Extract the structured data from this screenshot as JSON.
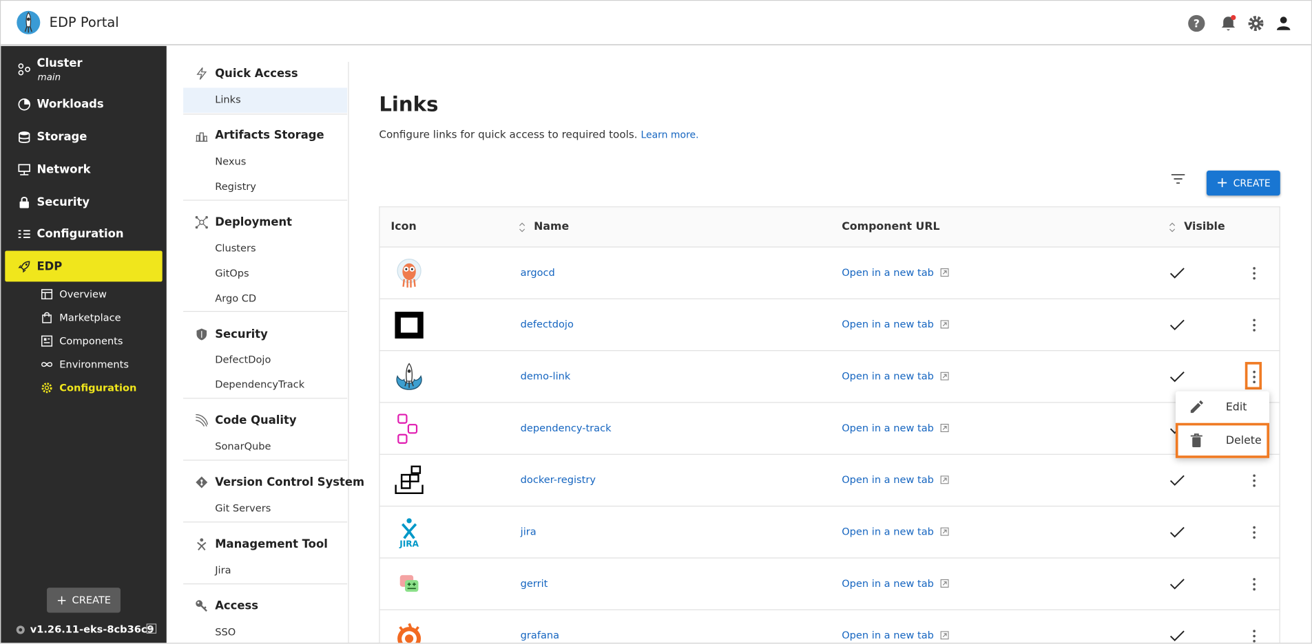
{
  "app": {
    "title": "EDP Portal"
  },
  "header": {
    "icons": [
      "help-icon",
      "notifications-icon",
      "settings-icon",
      "account-icon"
    ],
    "notification_dot_color": "#e53935"
  },
  "leftnav": {
    "items": [
      {
        "label": "Cluster",
        "sublabel": "main",
        "icon": "cluster-icon"
      },
      {
        "label": "Workloads",
        "icon": "workloads-icon"
      },
      {
        "label": "Storage",
        "icon": "storage-icon"
      },
      {
        "label": "Network",
        "icon": "network-icon"
      },
      {
        "label": "Security",
        "icon": "lock-icon"
      },
      {
        "label": "Configuration",
        "icon": "configuration-icon"
      },
      {
        "label": "EDP",
        "icon": "rocket-icon",
        "active": true
      }
    ],
    "subitems": [
      {
        "label": "Overview",
        "icon": "overview-icon"
      },
      {
        "label": "Marketplace",
        "icon": "marketplace-icon"
      },
      {
        "label": "Components",
        "icon": "components-icon"
      },
      {
        "label": "Environments",
        "icon": "environments-icon"
      },
      {
        "label": "Configuration",
        "icon": "gear-icon",
        "active": true
      }
    ],
    "create_label": "CREATE",
    "version": "v1.26.11-eks-8cb36c9",
    "active_color": "#f0e61c"
  },
  "subnav": {
    "sections": [
      {
        "title": "Quick Access",
        "icon": "bolt-icon",
        "links": [
          "Links"
        ]
      },
      {
        "title": "Artifacts Storage",
        "icon": "artifacts-icon",
        "links": [
          "Nexus",
          "Registry"
        ]
      },
      {
        "title": "Deployment",
        "icon": "deployment-icon",
        "links": [
          "Clusters",
          "GitOps",
          "Argo CD"
        ]
      },
      {
        "title": "Security",
        "icon": "shield-icon",
        "links": [
          "DefectDojo",
          "DependencyTrack"
        ]
      },
      {
        "title": "Code Quality",
        "icon": "code-quality-icon",
        "links": [
          "SonarQube"
        ]
      },
      {
        "title": "Version Control System",
        "icon": "git-icon",
        "links": [
          "Git Servers"
        ]
      },
      {
        "title": "Management Tool",
        "icon": "management-icon",
        "links": [
          "Jira"
        ]
      },
      {
        "title": "Access",
        "icon": "key-icon",
        "links": [
          "SSO"
        ]
      }
    ],
    "active_link": "Links"
  },
  "main": {
    "title": "Links",
    "description": "Configure links for quick access to required tools.",
    "learn_more": "Learn more.",
    "create_label": "CREATE",
    "accent_color": "#1976d2"
  },
  "table": {
    "columns": [
      "Icon",
      "Name",
      "Component URL",
      "Visible"
    ],
    "rows": [
      {
        "icon": "argocd-icon",
        "name": "argocd",
        "url_label": "Open in a new tab",
        "visible": true
      },
      {
        "icon": "defectdojo-icon",
        "name": "defectdojo",
        "url_label": "Open in a new tab",
        "visible": true
      },
      {
        "icon": "demo-link-icon",
        "name": "demo-link",
        "url_label": "Open in a new tab",
        "visible": true
      },
      {
        "icon": "dependency-track-icon",
        "name": "dependency-track",
        "url_label": "Open in a new tab",
        "visible": true
      },
      {
        "icon": "docker-registry-icon",
        "name": "docker-registry",
        "url_label": "Open in a new tab",
        "visible": true
      },
      {
        "icon": "jira-icon",
        "name": "jira",
        "url_label": "Open in a new tab",
        "visible": true,
        "icon_text": "JIRA"
      },
      {
        "icon": "gerrit-icon",
        "name": "gerrit",
        "url_label": "Open in a new tab",
        "visible": true
      },
      {
        "icon": "grafana-icon",
        "name": "grafana",
        "url_label": "Open in a new tab",
        "visible": true
      }
    ]
  },
  "actions_menu": {
    "items": [
      {
        "label": "Edit",
        "icon": "pencil-icon"
      },
      {
        "label": "Delete",
        "icon": "trash-icon"
      }
    ],
    "highlight_color": "#f07b24"
  }
}
